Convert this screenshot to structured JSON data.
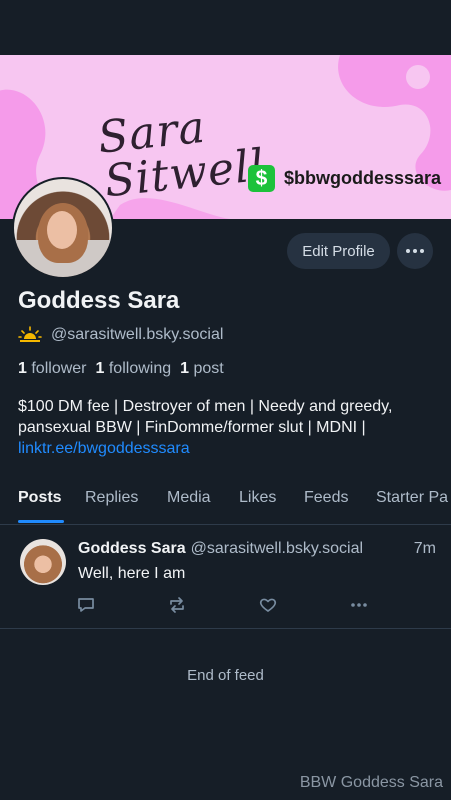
{
  "banner": {
    "name_line1": "Sara",
    "name_line2": "Sitwell",
    "cash_symbol": "$",
    "cashtag": "$bbwgoddesssara",
    "bg_color": "#f7c6f1",
    "blob_color": "#f59bea"
  },
  "profile": {
    "edit_label": "Edit Profile",
    "display_name": "Goddess Sara",
    "handle": "@sarasitwell.bsky.social",
    "handle_icon": "sunrise-icon",
    "followers_count": "1",
    "followers_label": "follower",
    "following_count": "1",
    "following_label": "following",
    "posts_count": "1",
    "posts_label": "post",
    "bio_text": "$100 DM fee | Destroyer of men | Needy and greedy, pansexual BBW | FinDomme/former slut | MDNI | ",
    "bio_link": "linktr.ee/bwgoddesssara"
  },
  "tabs": [
    {
      "label": "Posts",
      "active": true
    },
    {
      "label": "Replies",
      "active": false
    },
    {
      "label": "Media",
      "active": false
    },
    {
      "label": "Likes",
      "active": false
    },
    {
      "label": "Feeds",
      "active": false
    },
    {
      "label": "Starter Pa",
      "active": false
    }
  ],
  "post": {
    "author": "Goddess Sara",
    "handle": "@sarasitwell.bsky.social",
    "time": "7m",
    "text": "Well, here I am"
  },
  "feed_end": "End of feed",
  "watermark": "BBW Goddess Sara",
  "colors": {
    "background": "#161e27",
    "accent": "#208bfe",
    "button_bg": "#263241",
    "muted_text": "#aebbc9"
  }
}
